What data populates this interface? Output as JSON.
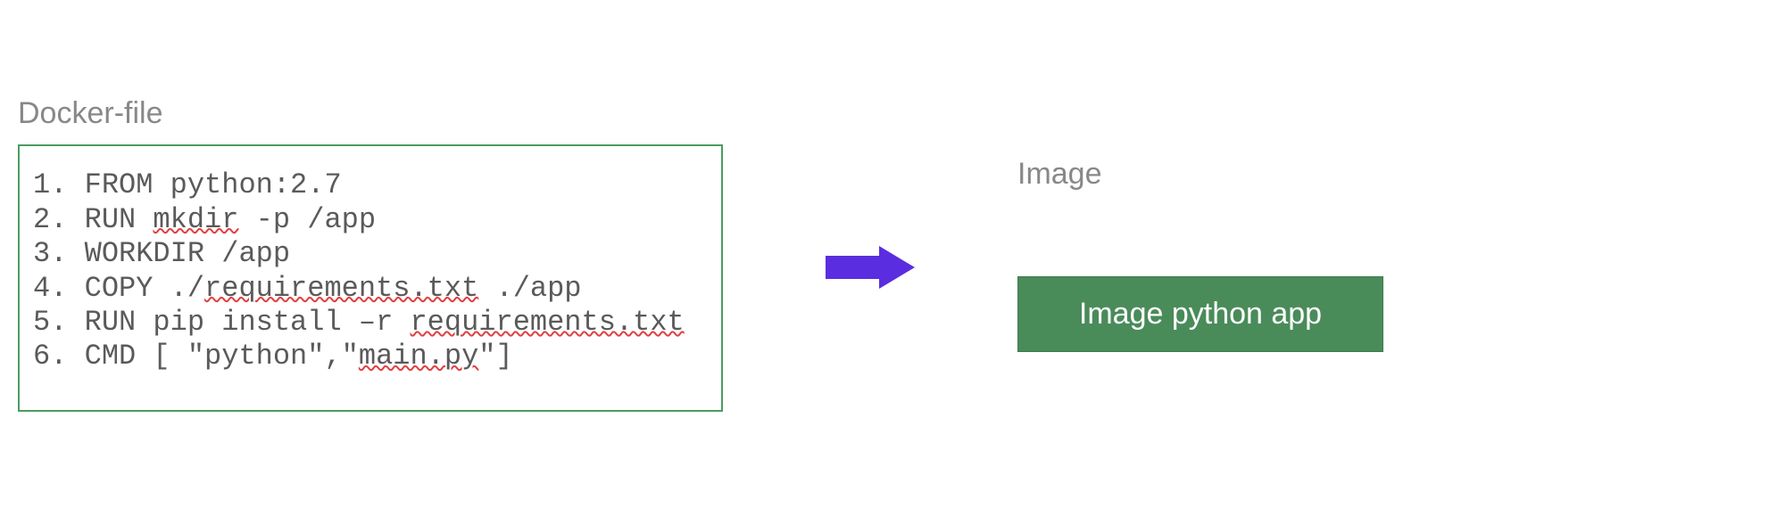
{
  "leftTitle": "Docker-file",
  "rightTitle": "Image",
  "imageBoxLabel": "Image python app",
  "code": {
    "line1": {
      "num": "1.",
      "pre": " FROM python:2.7"
    },
    "line2": {
      "num": "2.",
      "pre": " RUN ",
      "sq1": "mkdir",
      "post": " -p /app"
    },
    "line3": {
      "num": "3.",
      "pre": " WORKDIR /app"
    },
    "line4": {
      "num": "4.",
      "pre": " COPY ./",
      "sq1": "requirements.txt",
      "post": " ./app"
    },
    "line5": {
      "num": "5.",
      "pre": " RUN pip install –r ",
      "sq1": "requirements.txt"
    },
    "line6": {
      "num": "6.",
      "pre": " CMD [ \"python\",\"",
      "sq1": "main.py",
      "post": "\"]"
    }
  }
}
